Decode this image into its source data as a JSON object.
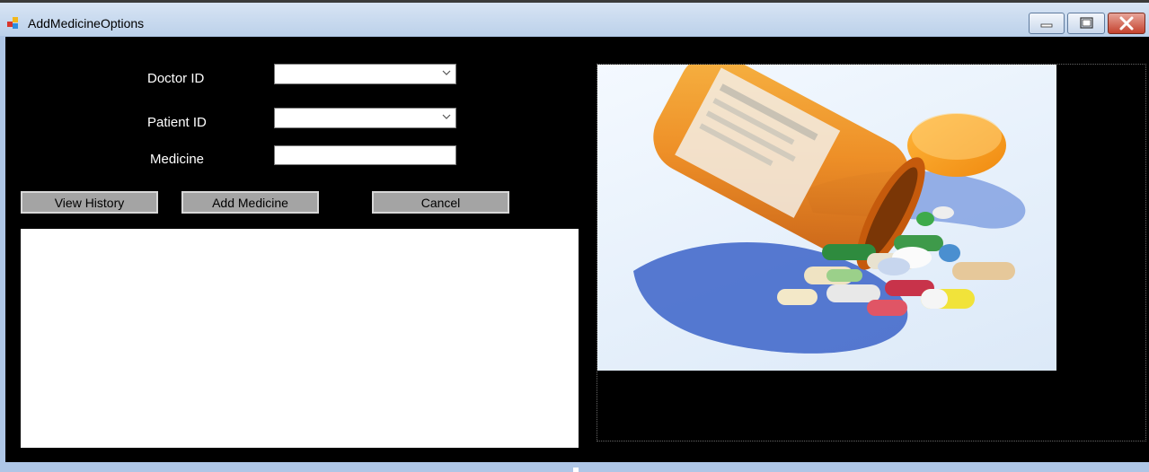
{
  "window": {
    "title": "AddMedicineOptions",
    "controls": [
      "minimize-icon",
      "maximize-icon",
      "close-icon"
    ]
  },
  "form": {
    "doctor_label": "Doctor ID",
    "doctor_value": "",
    "patient_label": "Patient ID",
    "patient_value": "",
    "medicine_label": "Medicine",
    "medicine_value": ""
  },
  "buttons": {
    "view_history": "View History",
    "add_medicine": "Add Medicine",
    "cancel": "Cancel"
  },
  "image": {
    "subject": "medicine-bottle-with-pills"
  },
  "colors": {
    "form_background": "#000000",
    "button_face": "#a4a4a4",
    "titlebar": "#c9dbf0"
  }
}
